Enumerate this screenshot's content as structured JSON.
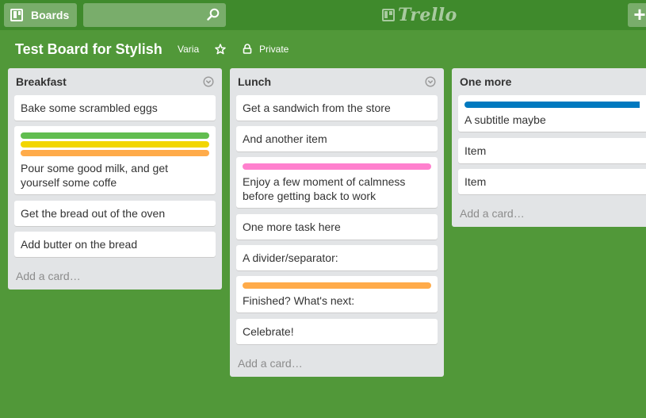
{
  "header": {
    "boards_label": "Boards",
    "search_placeholder": "",
    "logo_text": "Trello",
    "add_label": "+"
  },
  "board": {
    "title": "Test Board for Stylish",
    "team": "Varia",
    "visibility": "Private"
  },
  "lists": [
    {
      "title": "Breakfast",
      "add_card": "Add a card…",
      "cards": [
        {
          "text": "Bake some scrambled eggs",
          "labels": []
        },
        {
          "text": "Pour some good milk, and get yourself some coffe",
          "labels": [
            "#61bd4f",
            "#f2d600",
            "#ffab4a"
          ]
        },
        {
          "text": "Get the bread out of the oven",
          "labels": []
        },
        {
          "text": "Add butter on the bread",
          "labels": []
        }
      ]
    },
    {
      "title": "Lunch",
      "add_card": "Add a card…",
      "cards": [
        {
          "text": "Get a sandwich from the store",
          "labels": []
        },
        {
          "text": "And another item",
          "labels": []
        },
        {
          "text": "Enjoy a few moment of calmness before getting back to work",
          "labels": [
            "#ff80ce"
          ]
        },
        {
          "text": "One more task here",
          "labels": []
        },
        {
          "text": "A divider/separator:",
          "labels": []
        },
        {
          "text": "Finished? What's next:",
          "labels": [
            "#ffab4a"
          ]
        },
        {
          "text": "Celebrate!",
          "labels": []
        }
      ]
    },
    {
      "title": "One more",
      "add_card": "Add a card…",
      "cards": [
        {
          "text": "A subtitle maybe",
          "labels": [
            "#0079bf"
          ]
        },
        {
          "text": "Item",
          "labels": []
        },
        {
          "text": "Item",
          "labels": []
        }
      ]
    }
  ],
  "colors": {
    "background": "#519839",
    "header": "#3f8a2c",
    "list": "#e2e4e6"
  }
}
